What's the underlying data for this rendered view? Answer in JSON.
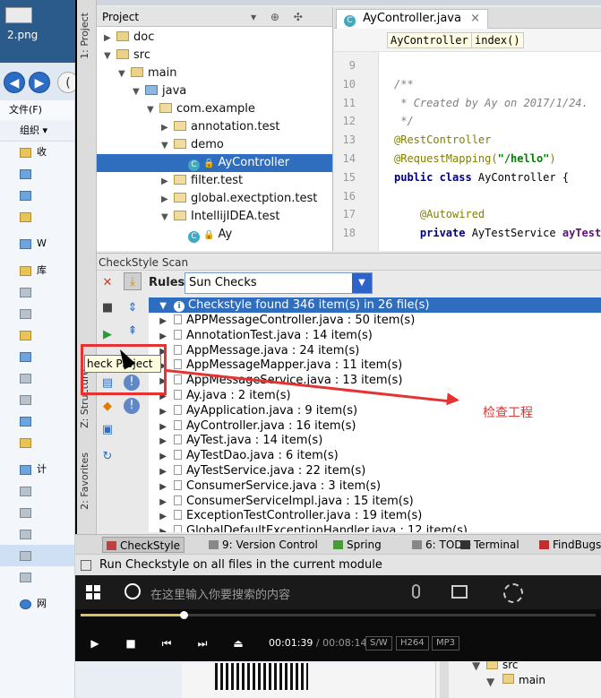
{
  "desktop": {
    "file_name": "2.png"
  },
  "explorer": {
    "menu": "文件(F)",
    "organize": "组织 ▾",
    "items": [
      {
        "label": "收",
        "icon": "star"
      },
      {
        "label": "",
        "icon": "download"
      },
      {
        "label": "",
        "icon": "desktop"
      },
      {
        "label": "",
        "icon": "folder"
      },
      {
        "label": "W",
        "icon": "cloud"
      },
      {
        "label": "库",
        "icon": "library"
      },
      {
        "label": "",
        "icon": "doc"
      },
      {
        "label": "",
        "icon": "film"
      },
      {
        "label": "",
        "icon": "folder"
      },
      {
        "label": "",
        "icon": "image"
      },
      {
        "label": "",
        "icon": "doc"
      },
      {
        "label": "",
        "icon": "doc"
      },
      {
        "label": "",
        "icon": "music"
      },
      {
        "label": "",
        "icon": "folder"
      },
      {
        "label": "计",
        "icon": "computer"
      },
      {
        "label": "",
        "icon": "drive"
      },
      {
        "label": "",
        "icon": "drive"
      },
      {
        "label": "",
        "icon": "drive"
      },
      {
        "label": "",
        "icon": "drive"
      },
      {
        "label": "",
        "icon": "drive"
      },
      {
        "label": "网",
        "icon": "network"
      }
    ]
  },
  "ide": {
    "side_tabs": {
      "project": "1: Project",
      "structure": "Z: Structure",
      "favorites": "2: Favorites"
    },
    "project_panel": {
      "title": "Project",
      "tree": [
        {
          "label": "doc",
          "kind": "folder",
          "depth": 0,
          "arrow": "▶"
        },
        {
          "label": "src",
          "kind": "folder",
          "depth": 0,
          "arrow": "▼"
        },
        {
          "label": "main",
          "kind": "folder",
          "depth": 1,
          "arrow": "▼"
        },
        {
          "label": "java",
          "kind": "java",
          "depth": 2,
          "arrow": "▼"
        },
        {
          "label": "com.example",
          "kind": "pkg",
          "depth": 3,
          "arrow": "▼"
        },
        {
          "label": "annotation.test",
          "kind": "pkg",
          "depth": 4,
          "arrow": "▶"
        },
        {
          "label": "demo",
          "kind": "pkg",
          "depth": 4,
          "arrow": "▼"
        },
        {
          "label": "AyController",
          "kind": "class",
          "depth": 5,
          "arrow": "",
          "selected": true
        },
        {
          "label": "filter.test",
          "kind": "pkg",
          "depth": 4,
          "arrow": "▶"
        },
        {
          "label": "global.exectption.test",
          "kind": "pkg",
          "depth": 4,
          "arrow": "▶"
        },
        {
          "label": "IntellijIDEA.test",
          "kind": "pkg",
          "depth": 4,
          "arrow": "▼"
        },
        {
          "label": "Ay",
          "kind": "class",
          "depth": 5,
          "arrow": ""
        }
      ]
    },
    "editor": {
      "tab_label": "AyController.java",
      "tab_close": "×",
      "crumbs": [
        "AyController",
        "index()"
      ],
      "lines": [
        {
          "n": "9",
          "parts": []
        },
        {
          "n": "10",
          "parts": [
            {
              "t": "/**",
              "c": "com"
            }
          ]
        },
        {
          "n": "11",
          "parts": [
            {
              "t": " * Created by Ay on 2017/1/24.",
              "c": "com"
            }
          ]
        },
        {
          "n": "12",
          "parts": [
            {
              "t": " */",
              "c": "com"
            }
          ]
        },
        {
          "n": "13",
          "parts": [
            {
              "t": "@RestController",
              "c": "ann"
            }
          ]
        },
        {
          "n": "14",
          "parts": [
            {
              "t": "@RequestMapping(",
              "c": "ann"
            },
            {
              "t": "\"/hello\"",
              "c": "str"
            },
            {
              "t": ")",
              "c": "ann"
            }
          ]
        },
        {
          "n": "15",
          "parts": [
            {
              "t": "public class ",
              "c": "kw"
            },
            {
              "t": "AyController {",
              "c": "plain"
            }
          ]
        },
        {
          "n": "16",
          "parts": []
        },
        {
          "n": "17",
          "parts": [
            {
              "t": "    @Autowired",
              "c": "ann"
            }
          ]
        },
        {
          "n": "18",
          "parts": [
            {
              "t": "    private ",
              "c": "kw"
            },
            {
              "t": "AyTestService ",
              "c": "plain"
            },
            {
              "t": "ayTestS",
              "c": "fld"
            }
          ]
        }
      ]
    },
    "checkstyle": {
      "title": "CheckStyle Scan",
      "rules_label": "Rules:",
      "rules_value": "Sun Checks",
      "summary": "Checkstyle found 346 item(s) in 26 file(s)",
      "results": [
        "APPMessageController.java : 50 item(s)",
        "AnnotationTest.java : 14 item(s)",
        "AppMessage.java : 24 item(s)",
        "AppMessageMapper.java : 11 item(s)",
        "AppMessageService.java : 13 item(s)",
        "Ay.java : 2 item(s)",
        "AyApplication.java : 9 item(s)",
        "AyController.java : 16 item(s)",
        "AyTest.java : 14 item(s)",
        "AyTestDao.java : 6 item(s)",
        "AyTestService.java : 22 item(s)",
        "ConsumerService.java : 3 item(s)",
        "ConsumerServiceImpl.java : 15 item(s)",
        "ExceptionTestController.java : 19 item(s)",
        "GlobalDefaultExceptionHandler.java : 12 item(s)"
      ],
      "tooltip": "heck Project"
    },
    "annotation": "检查工程",
    "bottom_tabs": [
      {
        "label": "CheckStyle",
        "active": true
      },
      {
        "label": "9: Version Control"
      },
      {
        "label": "Spring"
      },
      {
        "label": "6: TODO"
      },
      {
        "label": "Terminal"
      },
      {
        "label": "FindBugs"
      }
    ],
    "status_text": "Run Checkstyle on all files in the current module"
  },
  "taskbar": {
    "search_placeholder": "在这里输入你要搜索的内容"
  },
  "player": {
    "progress_fraction": 0.2,
    "current_time": "00:01:39",
    "total_time": "/ 00:08:14",
    "tags": [
      "S/W",
      "H264",
      "MP3"
    ]
  },
  "mini_tree": {
    "src": "src",
    "main": "main"
  },
  "colors": {
    "accent": "#2f6dbe",
    "annotation": "#e53333"
  }
}
